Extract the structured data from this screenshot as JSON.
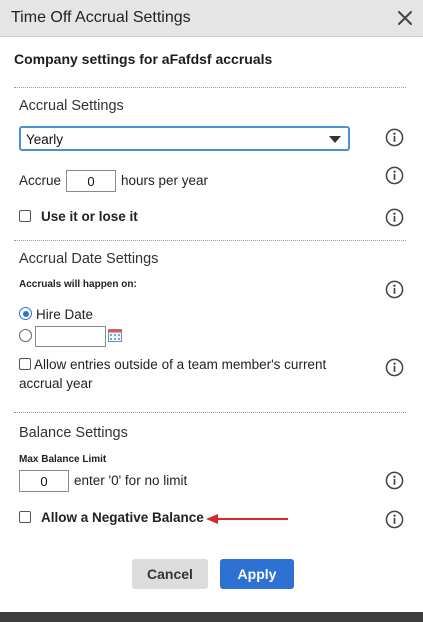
{
  "dialog": {
    "title": "Time Off Accrual Settings",
    "subtitle": "Company settings for aFafdsf accruals"
  },
  "accrual_settings": {
    "heading": "Accrual Settings",
    "frequency_selected": "Yearly",
    "accrue_label": "Accrue",
    "accrue_value": "0",
    "accrue_suffix": "hours per year",
    "use_it_or_lose_it_label": "Use it or lose it",
    "use_it_or_lose_it_checked": false
  },
  "accrual_date_settings": {
    "heading": "Accrual Date Settings",
    "happen_on_label": "Accruals will happen on:",
    "hire_date_label": "Hire Date",
    "hire_date_selected": true,
    "custom_date_value": "",
    "allow_entries_label_line1": "Allow entries outside of a team member's current",
    "allow_entries_label_line2": "accrual year",
    "allow_entries_checked": false
  },
  "balance_settings": {
    "heading": "Balance Settings",
    "max_balance_label": "Max Balance Limit",
    "max_balance_value": "0",
    "max_balance_hint": "enter '0' for no limit",
    "negative_balance_label": "Allow a Negative Balance",
    "negative_balance_checked": false
  },
  "buttons": {
    "cancel": "Cancel",
    "apply": "Apply"
  },
  "colors": {
    "accent": "#2d72d2",
    "annotation_arrow": "#d42a2a",
    "titlebar": "#e5e5e5"
  },
  "icons": [
    "close-icon",
    "info-icon",
    "calendar-icon",
    "chevron-down-icon",
    "red-arrow-annotation"
  ]
}
